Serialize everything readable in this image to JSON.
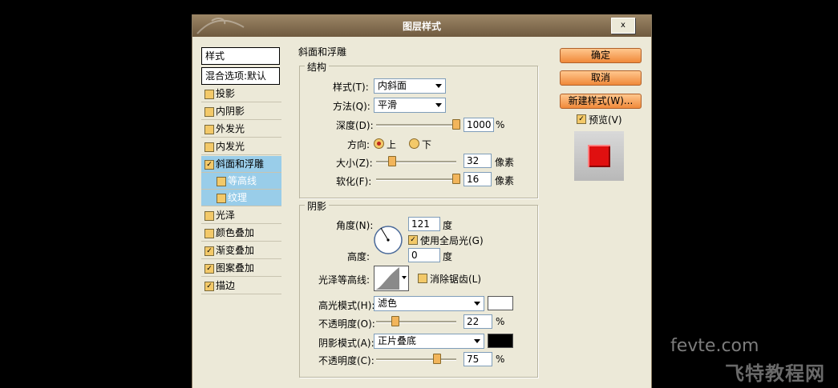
{
  "window": {
    "title": "图层样式",
    "close_label": "x"
  },
  "stylelist": {
    "header": "样式",
    "blend": "混合选项:默认",
    "items": [
      {
        "label": "投影",
        "checked": false
      },
      {
        "label": "内阴影",
        "checked": false
      },
      {
        "label": "外发光",
        "checked": false
      },
      {
        "label": "内发光",
        "checked": false
      },
      {
        "label": "斜面和浮雕",
        "checked": true,
        "selected": true
      },
      {
        "label": "等高线",
        "checked": false,
        "sub": true
      },
      {
        "label": "纹理",
        "checked": false,
        "sub": true
      },
      {
        "label": "光泽",
        "checked": false
      },
      {
        "label": "颜色叠加",
        "checked": false
      },
      {
        "label": "渐变叠加",
        "checked": true
      },
      {
        "label": "图案叠加",
        "checked": true
      },
      {
        "label": "描边",
        "checked": true
      }
    ]
  },
  "bevel": {
    "section": "斜面和浮雕",
    "structure": {
      "legend": "结构",
      "style_label": "样式(T):",
      "style_value": "内斜面",
      "technique_label": "方法(Q):",
      "technique_value": "平滑",
      "depth_label": "深度(D):",
      "depth_value": "1000",
      "depth_unit": "%",
      "direction_label": "方向:",
      "dir_up": "上",
      "dir_down": "下",
      "size_label": "大小(Z):",
      "size_value": "32",
      "size_unit": "像素",
      "soften_label": "软化(F):",
      "soften_value": "16",
      "soften_unit": "像素"
    },
    "shading": {
      "legend": "阴影",
      "angle_label": "角度(N):",
      "angle_value": "121",
      "angle_unit": "度",
      "global_light_label": "使用全局光(G)",
      "global_light_checked": true,
      "altitude_label": "高度:",
      "altitude_value": "0",
      "altitude_unit": "度",
      "gloss_label": "光泽等高线:",
      "antialias_label": "消除锯齿(L)",
      "antialias_checked": false,
      "highlight_label": "高光模式(H):",
      "highlight_value": "滤色",
      "highlight_color": "#ffffff",
      "hl_opacity_label": "不透明度(O):",
      "hl_opacity_value": "22",
      "hl_opacity_unit": "%",
      "shadow_label": "阴影模式(A):",
      "shadow_value": "正片叠底",
      "shadow_color": "#000000",
      "sh_opacity_label": "不透明度(C):",
      "sh_opacity_value": "75",
      "sh_opacity_unit": "%"
    }
  },
  "buttons": {
    "ok": "确定",
    "cancel": "取消",
    "new_style": "新建样式(W)...",
    "preview_label": "预览(V)",
    "preview_checked": true
  },
  "preview_color": "#e01010",
  "watermark": {
    "line1": "fevte.com",
    "line2": "飞特教程网"
  }
}
